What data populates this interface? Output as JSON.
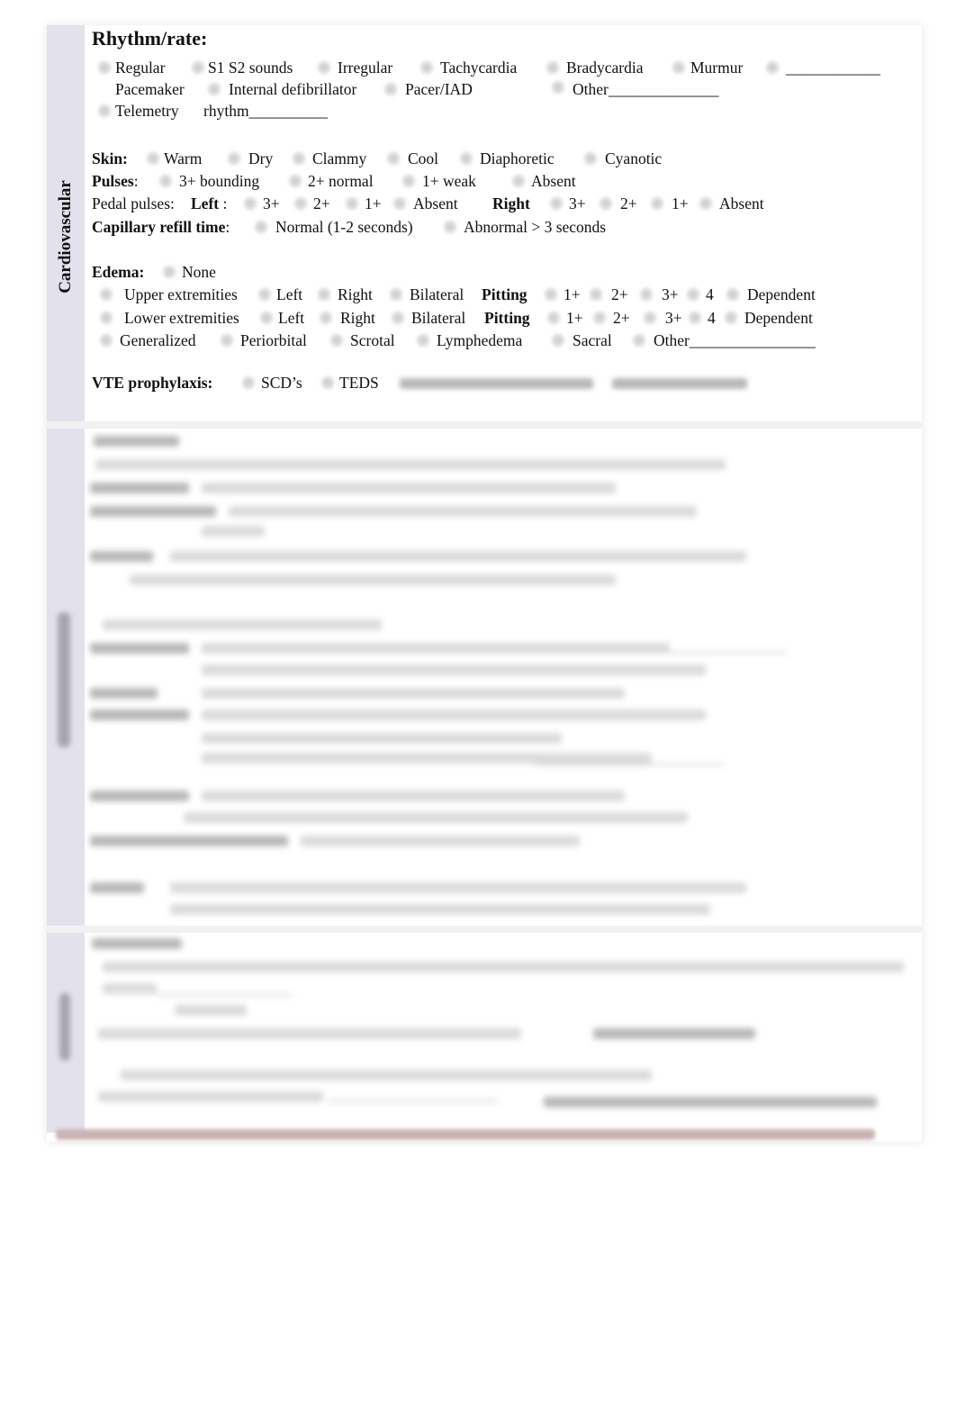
{
  "section_label": "Cardiovascular",
  "rhythm": {
    "title": "Rhythm/rate:",
    "row1": [
      "Regular",
      "S1 S2 sounds",
      "Irregular",
      "Tachycardia",
      "Bradycardia",
      "Murmur",
      "____________"
    ],
    "row2": [
      "Pacemaker",
      "Internal defibrillator",
      "Pacer/IAD",
      "Other______________"
    ],
    "row3": [
      "Telemetry",
      "rhythm__________"
    ]
  },
  "skin": {
    "label": "Skin:",
    "options": [
      "Warm",
      "Dry",
      "Clammy",
      "Cool",
      "Diaphoretic",
      "Cyanotic"
    ]
  },
  "pulses": {
    "label": "Pulses",
    "colon": ":",
    "options": [
      "3+ bounding",
      "2+ normal",
      "1+ weak",
      "Absent"
    ]
  },
  "pedal": {
    "label": "Pedal pulses:",
    "left_label": "Left",
    "left_colon": " :",
    "left_options": [
      "3+",
      "2+",
      "1+",
      "Absent"
    ],
    "right_label": "Right",
    "right_options": [
      "3+",
      "2+",
      "1+",
      "Absent"
    ]
  },
  "capillary": {
    "label": "Capillary refill time",
    "colon": ":",
    "options": [
      "Normal (1-2 seconds)",
      "Abnormal > 3 seconds"
    ]
  },
  "edema": {
    "label": "Edema:",
    "none": "None",
    "upper": {
      "label": "Upper extremities",
      "options": [
        "Left",
        "Right",
        "Bilateral"
      ],
      "pitting": "Pitting",
      "grades": [
        "1+",
        "2+",
        "3+",
        "4"
      ],
      "dependent": "Dependent"
    },
    "lower": {
      "label": "Lower extremities",
      "options": [
        "Left",
        "Right",
        "Bilateral"
      ],
      "pitting": "Pitting",
      "grades": [
        "1+",
        "2+",
        "3+",
        "4"
      ],
      "dependent": "Dependent"
    },
    "other_row": [
      "Generalized",
      "Periorbital",
      "Scrotal",
      "Lymphedema",
      "Sacral",
      "Other________________"
    ]
  },
  "vte": {
    "label": "VTE prophylaxis:",
    "options": [
      "SCD’s",
      "TEDS"
    ]
  }
}
